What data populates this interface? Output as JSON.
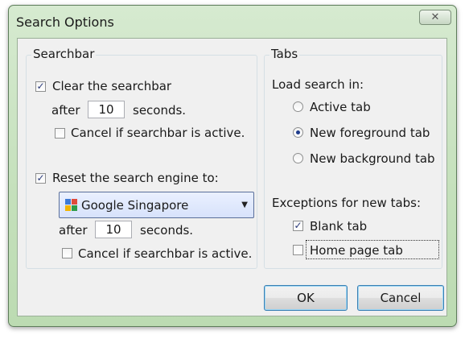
{
  "window": {
    "title": "Search Options",
    "close_symbol": "✕"
  },
  "searchbar": {
    "legend": "Searchbar",
    "clear": {
      "label": "Clear the searchbar",
      "checked": true
    },
    "after_label_1": "after",
    "seconds_1": "10",
    "seconds_label_1": "seconds.",
    "cancel_1": {
      "label": "Cancel if searchbar is active.",
      "checked": false
    },
    "reset": {
      "label": "Reset the search engine to:",
      "checked": true
    },
    "engine": {
      "selected": "Google Singapore"
    },
    "after_label_2": "after",
    "seconds_2": "10",
    "seconds_label_2": "seconds.",
    "cancel_2": {
      "label": "Cancel if searchbar is active.",
      "checked": false
    }
  },
  "tabs": {
    "legend": "Tabs",
    "load_label": "Load search in:",
    "options": [
      {
        "label": "Active tab",
        "selected": false
      },
      {
        "label": "New foreground tab",
        "selected": true
      },
      {
        "label": "New background tab",
        "selected": false
      }
    ],
    "exceptions_label": "Exceptions for new tabs:",
    "blank": {
      "label": "Blank tab",
      "checked": true
    },
    "home": {
      "label": "Home page tab",
      "checked": false
    }
  },
  "buttons": {
    "ok": "OK",
    "cancel": "Cancel"
  },
  "icons": {
    "check": "✓",
    "dropdown": "▼"
  },
  "colors": {
    "frame": "#c4e0bb",
    "client": "#f0f0f0",
    "accent": "#1e3c8c"
  }
}
